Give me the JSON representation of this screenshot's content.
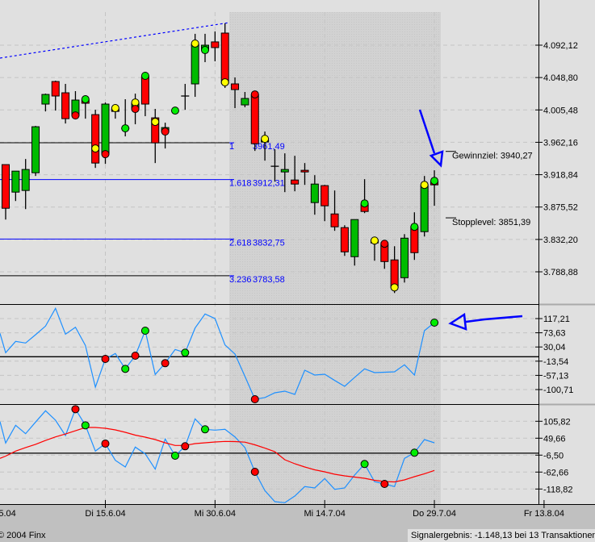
{
  "footer": {
    "copyright": "© 2004 Finx",
    "signal_result": "Signalergebnis: -1.148,13 bei 13 Transaktionen"
  },
  "colors": {
    "up": "#00bb00",
    "down": "#ff0000",
    "dot_yellow": "#ffff00",
    "dot_green": "#00ee00",
    "dot_red": "#ff0000",
    "indicator_line": "#1e90ff",
    "signal_line": "#ff0000",
    "fib_blue": "#0000ff",
    "arrow": "#0000ff"
  },
  "chart_data": [
    {
      "type": "candlestick",
      "title": "Price",
      "y_ticks": [
        "4.092,12",
        "4.048,80",
        "4.005,48",
        "3.962,16",
        "3.918,84",
        "3.875,52",
        "3.832,20",
        "3.788,88"
      ],
      "y_tick_values": [
        4092.12,
        4048.8,
        4005.48,
        3962.16,
        3918.84,
        3875.52,
        3832.2,
        3788.88
      ],
      "x_ticks": [
        {
          "label": "Fr 28.5.04",
          "index": 0
        },
        {
          "label": "Di 15.6.04",
          "index": 11
        },
        {
          "label": "Mi 30.6.04",
          "index": 22
        },
        {
          "label": "Mi 14.7.04",
          "index": 33
        },
        {
          "label": "Do 29.7.04",
          "index": 44
        },
        {
          "label": "Fr 13.8.04",
          "index": 55
        }
      ],
      "ohlc": [
        [
          3932.3,
          3932.3,
          3858.8,
          3873.9
        ],
        [
          3895.5,
          3923.6,
          3883.6,
          3923.6
        ],
        [
          3897.7,
          3939.8,
          3872.8,
          3925.8
        ],
        [
          3921.4,
          3984.1,
          3917.1,
          3983.0
        ],
        [
          4013.3,
          4027.3,
          4003.5,
          4026.2
        ],
        [
          4043.5,
          4044.6,
          4004.6,
          4024.1
        ],
        [
          4028.4,
          4040.3,
          3987.3,
          3993.8
        ],
        [
          3998.1,
          4030.6,
          3993.8,
          4018.7
        ],
        [
          4018.7,
          4023.0,
          3993.8,
          4014.4
        ],
        [
          3999.2,
          4005.7,
          3927.9,
          3934.4
        ],
        [
          3946.3,
          4015.4,
          3933.3,
          4013.3
        ],
        [
          4006.8,
          4010.0,
          3993.8,
          4003.5
        ],
        [
          3980.9,
          4019.8,
          3970.1,
          3980.9
        ],
        [
          4006.8,
          4027.3,
          3986.3,
          4014.4
        ],
        [
          4050.0,
          4056.5,
          3997.1,
          4013.3
        ],
        [
          3994.9,
          4006.8,
          3934.4,
          3961.4
        ],
        [
          3976.5,
          3988.4,
          3953.9,
          3981.9
        ],
        [
          4004.6,
          4004.6,
          4004.6,
          4004.6
        ],
        [
          4024.1,
          4040.3,
          4005.7,
          4024.1
        ],
        [
          4040.3,
          4107.3,
          4023.0,
          4093.2
        ],
        [
          4085.6,
          4107.3,
          4069.4,
          4092.1
        ],
        [
          4096.5,
          4110.5,
          4070.5,
          4088.9
        ],
        [
          4108.3,
          4121.3,
          4034.9,
          4041.4
        ],
        [
          4040.3,
          4048.9,
          4007.9,
          4032.7
        ],
        [
          4012.2,
          4029.5,
          4009.0,
          4020.8
        ],
        [
          4025.2,
          4028.4,
          3950.6,
          3960.3
        ],
        [
          3962.5,
          3976.5,
          3937.6,
          3965.7
        ],
        [
          3930.1,
          3952.8,
          3909.6,
          3930.1
        ],
        [
          3922.5,
          3947.4,
          3895.5,
          3925.8
        ],
        [
          3911.7,
          3944.1,
          3896.6,
          3906.3
        ],
        [
          3924.7,
          3934.4,
          3905.2,
          3922.5
        ],
        [
          3881.5,
          3918.2,
          3865.3,
          3906.3
        ],
        [
          3904.2,
          3905.2,
          3856.6,
          3877.2
        ],
        [
          3866.3,
          3897.7,
          3843.7,
          3849.1
        ],
        [
          3848.0,
          3851.2,
          3810.2,
          3815.6
        ],
        [
          3809.1,
          3858.8,
          3797.2,
          3858.8
        ],
        [
          3879.3,
          3912.8,
          3867.4,
          3869.6
        ],
        [
          3830.7,
          3835.0,
          3803.7,
          3827.5
        ],
        [
          3825.3,
          3828.5,
          3792.9,
          3802.6
        ],
        [
          3804.8,
          3823.1,
          3760.5,
          3768.0
        ],
        [
          3781.0,
          3839.3,
          3774.5,
          3833.9
        ],
        [
          3849.1,
          3868.5,
          3804.8,
          3814.5
        ],
        [
          3842.6,
          3917.1,
          3836.1,
          3904.2
        ],
        [
          3909.6,
          3924.7,
          3877.2,
          3905.2
        ]
      ],
      "markers": [
        {
          "i": 8,
          "p": 3998.1,
          "c": "red"
        },
        {
          "i": 9,
          "p": 4019.8,
          "c": "green"
        },
        {
          "i": 10,
          "p": 3953.9,
          "c": "yellow"
        },
        {
          "i": 11,
          "p": 3946.3,
          "c": "red"
        },
        {
          "i": 12,
          "p": 4007.9,
          "c": "yellow"
        },
        {
          "i": 13,
          "p": 3980.9,
          "c": "green"
        },
        {
          "i": 14,
          "p": 4015.4,
          "c": "yellow"
        },
        {
          "i": 14,
          "p": 4006.8,
          "c": "red"
        },
        {
          "i": 15,
          "p": 4051.1,
          "c": "green"
        },
        {
          "i": 16,
          "p": 3989.5,
          "c": "yellow"
        },
        {
          "i": 17,
          "p": 3976.5,
          "c": "red"
        },
        {
          "i": 18,
          "p": 4004.6,
          "c": "green"
        },
        {
          "i": 20,
          "p": 4094.3,
          "c": "yellow"
        },
        {
          "i": 21,
          "p": 4085.6,
          "c": "green"
        },
        {
          "i": 23,
          "p": 4042.4,
          "c": "yellow"
        },
        {
          "i": 26,
          "p": 4026.2,
          "c": "red"
        },
        {
          "i": 27,
          "p": 3966.8,
          "c": "yellow"
        },
        {
          "i": 37,
          "p": 3880.4,
          "c": "green"
        },
        {
          "i": 38,
          "p": 3830.7,
          "c": "yellow"
        },
        {
          "i": 39,
          "p": 3826.4,
          "c": "red"
        },
        {
          "i": 40,
          "p": 3768.0,
          "c": "yellow"
        },
        {
          "i": 42,
          "p": 3849.1,
          "c": "green"
        },
        {
          "i": 43,
          "p": 3905.2,
          "c": "yellow"
        },
        {
          "i": 44,
          "p": 3910.6,
          "c": "green"
        }
      ],
      "fib_levels": [
        {
          "ratio": "1",
          "value": "3961,49",
          "price": 3961.49,
          "line_color": "#000000"
        },
        {
          "ratio": "1.618",
          "value": "3912,31",
          "price": 3912.31,
          "line_color": "#0000ff"
        },
        {
          "ratio": "2.618",
          "value": "3832,75",
          "price": 3832.75,
          "line_color": "#0000ff"
        },
        {
          "ratio": "3.236",
          "value": "3783,58",
          "price": 3783.58,
          "line_color": "#000000"
        }
      ],
      "targets": [
        {
          "label": "Gewinnziel: 3940,27",
          "price": 3940.27
        },
        {
          "label": "Stopplevel: 3851,39",
          "price": 3851.39
        }
      ]
    },
    {
      "type": "line",
      "title": "Indicator 1",
      "y_ticks": [
        "117,21",
        "73,63",
        "30,04",
        "-13,54",
        "-57,13",
        "-100,71"
      ],
      "y_tick_values": [
        117.21,
        73.63,
        30.04,
        -13.54,
        -57.13,
        -100.71
      ],
      "zero_line": 0,
      "series": [
        {
          "name": "indicator",
          "values": [
            71.9,
            12.5,
            47.1,
            42.2,
            67.7,
            94.2,
            148.7,
            69.4,
            90.7,
            34.7,
            -93.3,
            -6.6,
            10.0,
            -37.1,
            3.3,
            80.1,
            -54.4,
            -19.7,
            22.4,
            12.5,
            88.2,
            131.3,
            117.2,
            36.2,
            8.3,
            -60.3,
            -130.4,
            -125.4,
            -110.6,
            -105.6,
            -115.5,
            -41.3,
            -56.1,
            -53.6,
            -72.7,
            -90.8,
            -63.5,
            -37.1,
            -48.7,
            -47.5,
            -46.2,
            -24.7,
            -56.1,
            80.1,
            104.8
          ]
        }
      ],
      "markers": [
        {
          "i": 11,
          "c": "red"
        },
        {
          "i": 13,
          "c": "green"
        },
        {
          "i": 14,
          "c": "red"
        },
        {
          "i": 15,
          "c": "green"
        },
        {
          "i": 17,
          "c": "red"
        },
        {
          "i": 19,
          "c": "green"
        },
        {
          "i": 26,
          "c": "red"
        },
        {
          "i": 44,
          "c": "green"
        }
      ]
    },
    {
      "type": "line",
      "title": "Indicator 2",
      "y_ticks": [
        "105,82",
        "49,66",
        "-6,50",
        "-62,66",
        "-118,82"
      ],
      "y_tick_values": [
        105.82,
        49.66,
        -6.5,
        -62.66,
        -118.82
      ],
      "zero_line": 0,
      "series": [
        {
          "name": "indicator",
          "values": [
            104.7,
            33.6,
            92.4,
            64.6,
            103.1,
            140.6,
            109.3,
            58.5,
            145.9,
            92.4,
            6.9,
            31.7,
            -23.6,
            -45.8,
            20.2,
            -2.2,
            -53.0,
            47.0,
            -8.4,
            22.9,
            113.8,
            79.1,
            76.4,
            79.1,
            53.9,
            18.4,
            -61.9,
            -124.2,
            -160.8,
            -164.3,
            -142.1,
            -110.8,
            -115.3,
            -84.1,
            -119.9,
            -115.3,
            -72.6,
            -35.9,
            -94.7,
            -102.0,
            -110.8,
            -17.2,
            1.5,
            45.1,
            34.4
          ]
        },
        {
          "name": "signal",
          "values": [
            -17.2,
            -9.7,
            6.9,
            18.4,
            29.1,
            42.4,
            53.9,
            63.8,
            74.5,
            85.2,
            85.2,
            82.5,
            77.2,
            69.2,
            59.8,
            53.1,
            45.1,
            34.4,
            25.6,
            25.6,
            31.7,
            34.4,
            37.1,
            38.9,
            38.4,
            36.6,
            27.7,
            17.0,
            5.0,
            -21.8,
            -35.1,
            -45.8,
            -55.2,
            -61.9,
            -69.9,
            -75.2,
            -79.2,
            -83.2,
            -89.9,
            -93.9,
            -95.3,
            -88.6,
            -77.9,
            -68.5,
            -57.3
          ]
        }
      ],
      "markers": [
        {
          "i": 8,
          "c": "red"
        },
        {
          "i": 9,
          "c": "green"
        },
        {
          "i": 11,
          "c": "red"
        },
        {
          "i": 18,
          "c": "green"
        },
        {
          "i": 19,
          "c": "red"
        },
        {
          "i": 21,
          "c": "green"
        },
        {
          "i": 26,
          "c": "red"
        },
        {
          "i": 37,
          "c": "green"
        },
        {
          "i": 39,
          "c": "red"
        },
        {
          "i": 42,
          "c": "green"
        }
      ]
    }
  ]
}
